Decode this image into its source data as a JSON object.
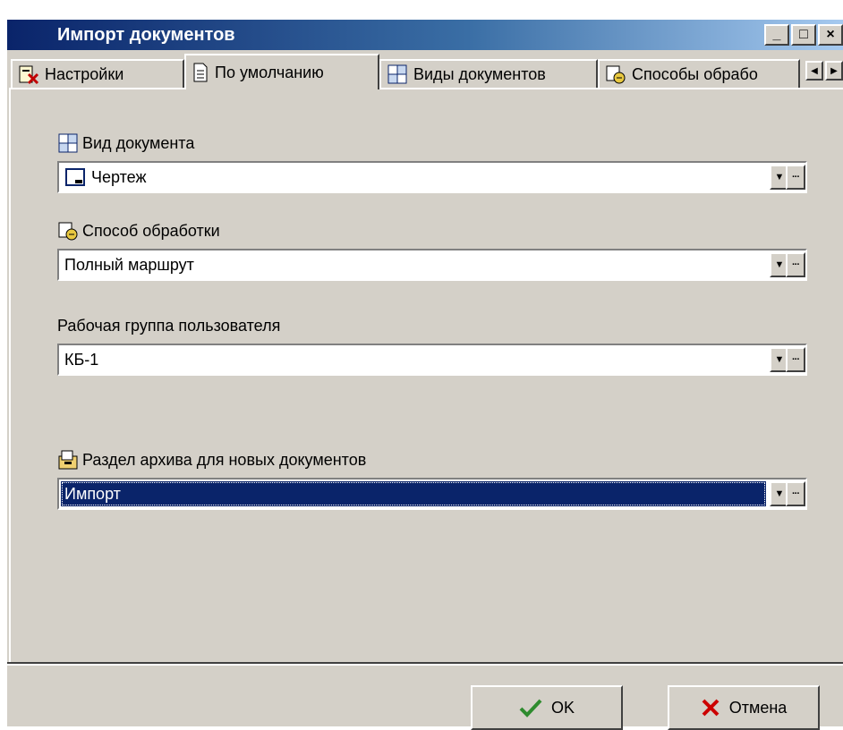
{
  "window": {
    "title": "Импорт документов"
  },
  "title_buttons": {
    "minimize": "_",
    "maximize": "□",
    "close": "×"
  },
  "tabs": [
    {
      "label": "Настройки",
      "icon": "settings-doc-icon"
    },
    {
      "label": "По умолчанию",
      "icon": "page-icon"
    },
    {
      "label": "Виды документов",
      "icon": "doc-types-icon"
    },
    {
      "label": "Способы обрабо",
      "icon": "processing-icon"
    }
  ],
  "tab_scroll": {
    "left": "◀",
    "right": "▶"
  },
  "fields": {
    "doc_type": {
      "label": "Вид документа",
      "value": "Чертеж"
    },
    "processing": {
      "label": "Способ обработки",
      "value": "Полный маршрут"
    },
    "workgroup": {
      "label": "Рабочая группа пользователя",
      "value": "КБ-1"
    },
    "archive_section": {
      "label": "Раздел архива для новых документов",
      "value": "Импорт"
    }
  },
  "combo_buttons": {
    "dropdown": "▼",
    "ellipsis": "···"
  },
  "buttons": {
    "ok": "OK",
    "cancel": "Отмена"
  },
  "colors": {
    "title_start": "#0a246a",
    "selection": "#0a246a",
    "ok_check": "#2e8b2e",
    "cancel_x": "#cc0000",
    "face": "#d4d0c8"
  }
}
